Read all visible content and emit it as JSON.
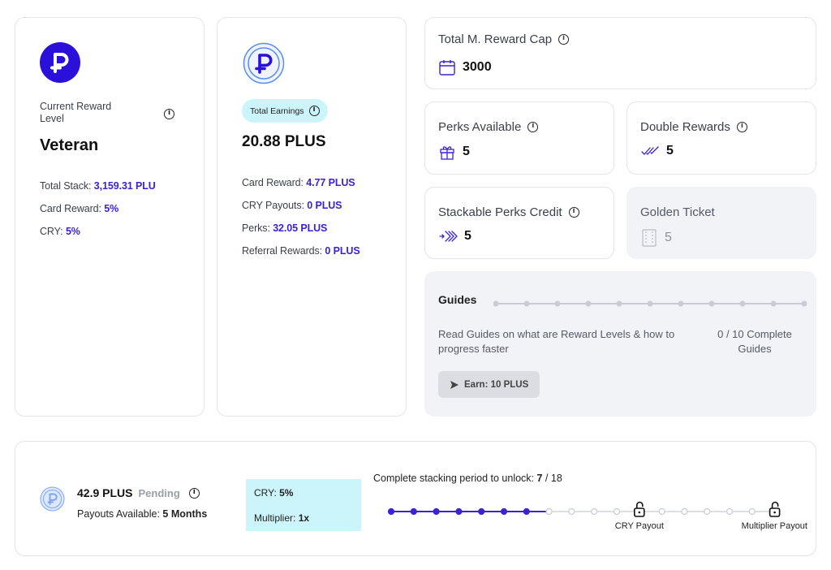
{
  "level_card": {
    "label": "Current Reward Level",
    "level": "Veteran",
    "details": [
      {
        "label": "Total Stack: ",
        "value": "3,159.31 PLU"
      },
      {
        "label": "Card Reward: ",
        "value": "5%"
      },
      {
        "label": "CRY: ",
        "value": "5%"
      }
    ]
  },
  "earnings_card": {
    "badge_label": "Total Earnings",
    "total": "20.88 PLUS",
    "details": [
      {
        "label": "Card Reward: ",
        "value": "4.77 PLUS"
      },
      {
        "label": "CRY Payouts: ",
        "value": "0 PLUS"
      },
      {
        "label": "Perks: ",
        "value": "32.05 PLUS"
      },
      {
        "label": "Referral Rewards: ",
        "value": "0 PLUS"
      }
    ]
  },
  "reward_cap": {
    "title": "Total M. Reward Cap",
    "value": "3000",
    "icon": "calendar-icon"
  },
  "perks_available": {
    "title": "Perks Available",
    "value": "5",
    "icon": "gift-icon"
  },
  "double_rewards": {
    "title": "Double Rewards",
    "value": "5",
    "icon": "double-check-icon"
  },
  "stackable_perks": {
    "title": "Stackable Perks Credit",
    "value": "5",
    "icon": "chevrons-right-icon"
  },
  "golden_ticket": {
    "title": "Golden Ticket",
    "value": "5",
    "icon": "ticket-icon"
  },
  "guides": {
    "title": "Guides",
    "description": "Read Guides on what are Reward Levels & how to progress faster",
    "progress_text": "0 / 10 Complete Guides",
    "completed": 0,
    "total": 10,
    "earn_button": "Earn: 10 PLUS"
  },
  "pending": {
    "amount": "42.9 PLUS",
    "status": "Pending",
    "payouts_label": "Payouts Available: ",
    "payouts_value": "5 Months",
    "cry_label": "CRY: ",
    "cry_value": "5%",
    "multiplier_label": "Multiplier: ",
    "multiplier_value": "1x",
    "stacking_label": "Complete stacking period to unlock: ",
    "stacking_done": "7",
    "stacking_total": "18",
    "stacking_done_num": 7,
    "stacking_total_num": 18,
    "milestones": [
      {
        "label": "CRY Payout",
        "step": 11
      },
      {
        "label": "Multiplier Payout",
        "step": 17
      }
    ]
  },
  "colors": {
    "accent": "#3d22d4",
    "accent_light": "#5b8def",
    "cyan_badge": "#ccf4fb"
  }
}
